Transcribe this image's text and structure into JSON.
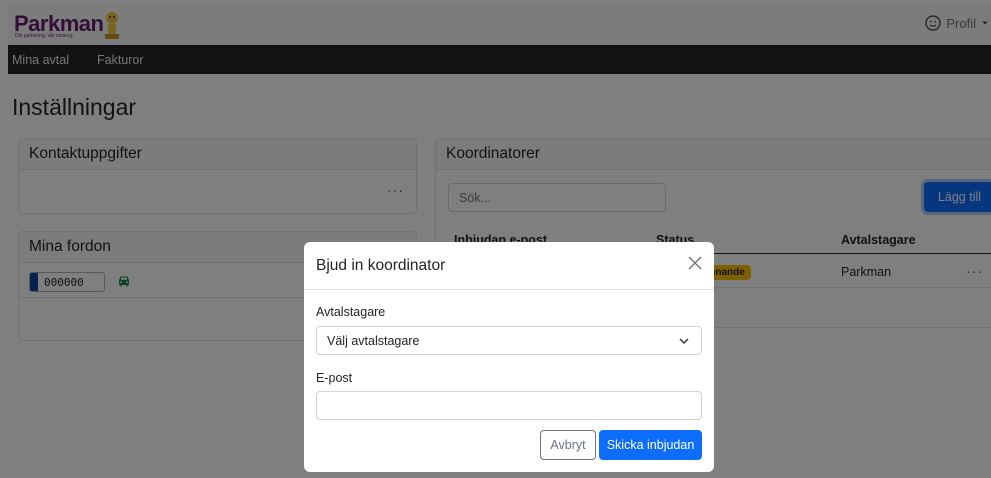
{
  "header": {
    "logo_text": "Parkman",
    "logo_tagline": "Din parkering, vår omsorg",
    "profile_label": "Profil"
  },
  "nav": {
    "items": [
      {
        "label": "Mina avtal"
      },
      {
        "label": "Fakturor"
      }
    ]
  },
  "page": {
    "title": "Inställningar"
  },
  "contact_card": {
    "title": "Kontaktuppgifter",
    "menu": "···"
  },
  "vehicles_card": {
    "title": "Mina fordon",
    "plate": "000000"
  },
  "coordinators": {
    "title": "Koordinatorer",
    "search_placeholder": "Sök...",
    "add_button": "Lägg till",
    "columns": [
      "Inbjudan e-post",
      "Status",
      "Avtalstagare"
    ],
    "rows": [
      {
        "email": "",
        "status": "Väntar godkännande",
        "status_visible": "dkännande",
        "contractor": "Parkman",
        "menu": "···"
      }
    ]
  },
  "modal": {
    "title": "Bjud in koordinator",
    "contractor_label": "Avtalstagare",
    "contractor_select": "Välj avtalstagare",
    "email_label": "E-post",
    "email_value": "",
    "cancel_button": "Avbryt",
    "submit_button": "Skicka inbjudan"
  },
  "colors": {
    "primary": "#0d6efd",
    "navbar": "#212529",
    "warning_badge": "#ffc107",
    "brand": "#6a1d6e"
  }
}
